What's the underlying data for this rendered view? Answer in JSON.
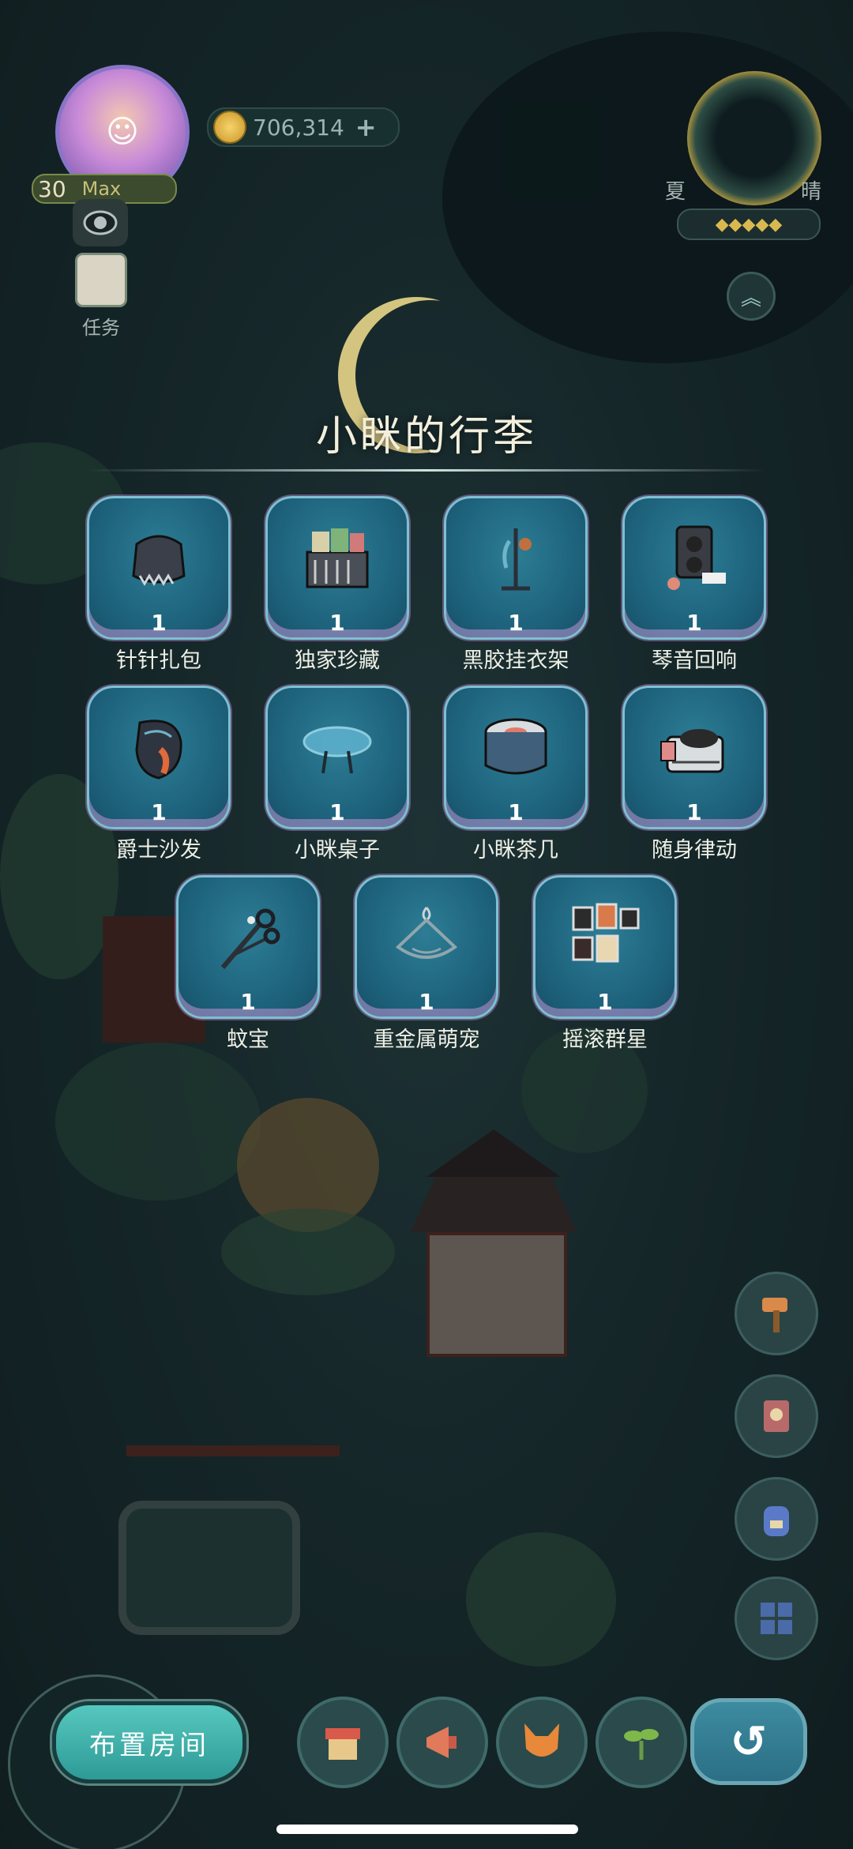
{
  "hud": {
    "level": "30",
    "level_max_label": "Max",
    "coins": "706,314",
    "coin_plus": "+",
    "task_label": "任务",
    "season_left": "夏",
    "season_right": "晴",
    "stars": "◆◆◆◆◆",
    "chevron": "︽"
  },
  "panel": {
    "title": "小眯的行李",
    "items": [
      {
        "label": "针针扎包",
        "qty": "1",
        "icon": "spiky-bag-icon",
        "color": "#3a3f4a"
      },
      {
        "label": "独家珍藏",
        "qty": "1",
        "icon": "record-shelf-icon",
        "color": "#5a5e66"
      },
      {
        "label": "黑胶挂衣架",
        "qty": "1",
        "icon": "coat-rack-icon",
        "color": "#2f4656"
      },
      {
        "label": "琴音回响",
        "qty": "1",
        "icon": "speaker-icon",
        "color": "#3a3c44"
      },
      {
        "label": "爵士沙发",
        "qty": "1",
        "icon": "jazz-sofa-icon",
        "color": "#2f3540"
      },
      {
        "label": "小眯桌子",
        "qty": "1",
        "icon": "glass-table-icon",
        "color": "#3d7f98"
      },
      {
        "label": "小眯茶几",
        "qty": "1",
        "icon": "tea-table-icon",
        "color": "#3f5f7a"
      },
      {
        "label": "随身律动",
        "qty": "1",
        "icon": "record-player-icon",
        "color": "#d8dde0"
      },
      {
        "label": "蚊宝",
        "qty": "1",
        "icon": "scissors-icon",
        "color": "#2b2f36"
      },
      {
        "label": "重金属萌宠",
        "qty": "1",
        "icon": "metal-hanger-icon",
        "color": "#3a5a6a"
      },
      {
        "label": "摇滚群星",
        "qty": "1",
        "icon": "photo-wall-icon",
        "color": "#d9b88a"
      }
    ]
  },
  "bottom": {
    "arrange_button": "布置房间",
    "back_icon": "↺"
  }
}
